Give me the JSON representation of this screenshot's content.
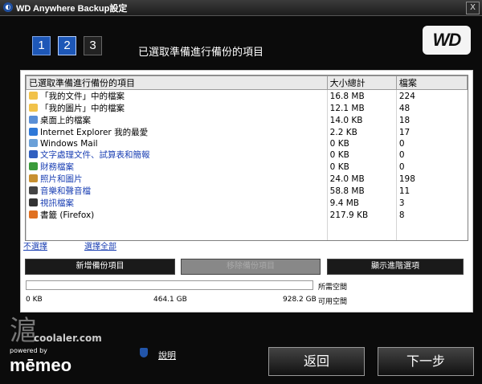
{
  "window": {
    "title": "WD Anywhere Backup設定",
    "close_glyph": "X"
  },
  "steps": [
    "1",
    "2",
    "3"
  ],
  "heading": "已選取準備進行備份的項目",
  "logo": "WD",
  "columns": [
    "已選取準備進行備份的項目",
    "大小總計",
    "檔案"
  ],
  "rows": [
    {
      "name": "「我的文件」中的檔案",
      "size": "16.8 MB",
      "files": "224",
      "icon": "folder-documents-icon",
      "color": "#f1c24a",
      "blue": false
    },
    {
      "name": "「我的圖片」中的檔案",
      "size": "12.1 MB",
      "files": "48",
      "icon": "folder-pictures-icon",
      "color": "#f1c24a",
      "blue": false
    },
    {
      "name": "桌面上的檔案",
      "size": "14.0 KB",
      "files": "18",
      "icon": "desktop-icon",
      "color": "#5a8fd6",
      "blue": false
    },
    {
      "name": "Internet Explorer 我的最愛",
      "size": "2.2 KB",
      "files": "17",
      "icon": "internet-explorer-icon",
      "color": "#2e78d8",
      "blue": false
    },
    {
      "name": "Windows Mail",
      "size": "0 KB",
      "files": "0",
      "icon": "windows-mail-icon",
      "color": "#6aa0d8",
      "blue": false
    },
    {
      "name": "文字處理文件、試算表和簡報",
      "size": "0 KB",
      "files": "0",
      "icon": "word-document-icon",
      "color": "#3060c0",
      "blue": true
    },
    {
      "name": "財務檔案",
      "size": "0 KB",
      "files": "0",
      "icon": "finance-icon",
      "color": "#3a9a3a",
      "blue": true
    },
    {
      "name": "照片和圖片",
      "size": "24.0 MB",
      "files": "198",
      "icon": "photos-icon",
      "color": "#c89030",
      "blue": true
    },
    {
      "name": "音樂和聲音檔",
      "size": "58.8 MB",
      "files": "11",
      "icon": "music-icon",
      "color": "#444444",
      "blue": true
    },
    {
      "name": "視訊檔案",
      "size": "9.4 MB",
      "files": "3",
      "icon": "video-icon",
      "color": "#333333",
      "blue": true
    },
    {
      "name": "書籤 (Firefox)",
      "size": "217.9 KB",
      "files": "8",
      "icon": "firefox-icon",
      "color": "#e07020",
      "blue": false
    }
  ],
  "links": {
    "deselect": "不選擇",
    "select_all": "選擇全部"
  },
  "buttons": {
    "add": "新增備份項目",
    "disabled": "移除備份項目",
    "advanced": "顯示進階選項"
  },
  "capacity": {
    "start": "0 KB",
    "mid": "464.1 GB",
    "end": "928.2 GB",
    "required_label": "所需空間",
    "available_label": "可用空間",
    "used_fraction": 0.0
  },
  "watermark": {
    "cn": "滬",
    "site": "coolaler.com"
  },
  "brand": {
    "powered_by": "powered by",
    "name": "mēmeo"
  },
  "footer": {
    "help": "說明",
    "back": "返回",
    "next": "下一步"
  }
}
